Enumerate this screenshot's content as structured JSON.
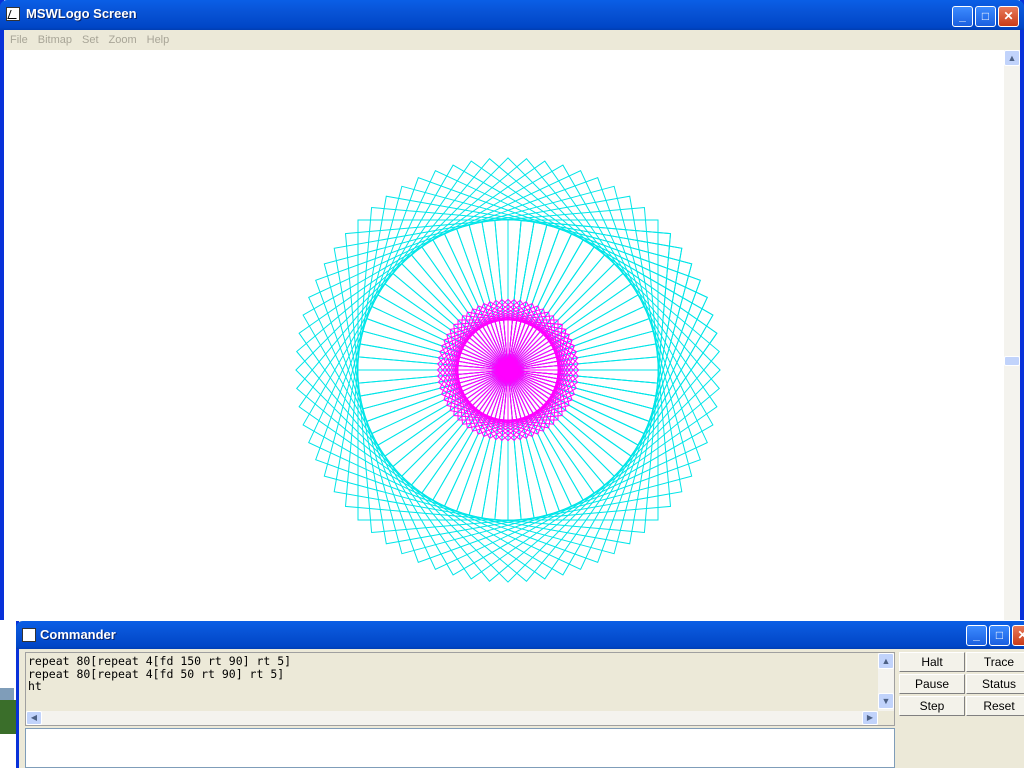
{
  "main_window": {
    "title": "MSWLogo Screen",
    "controls": {
      "minimize": "_",
      "maximize": "□",
      "close": "✕"
    },
    "menu": [
      "File",
      "Bitmap",
      "Set",
      "Zoom",
      "Help"
    ]
  },
  "drawing": {
    "shapes": [
      {
        "name": "large-square-rosette",
        "repeat": 80,
        "side": 150,
        "turn": 5,
        "color": "#00e5e8"
      },
      {
        "name": "small-square-rosette",
        "repeat": 80,
        "side": 50,
        "turn": 5,
        "color": "#ff00ff"
      }
    ]
  },
  "commander": {
    "title": "Commander",
    "history": [
      "repeat 80[repeat 4[fd 150 rt 90] rt 5]",
      "repeat 80[repeat 4[fd 50 rt 90] rt 5]",
      "ht"
    ],
    "input_value": "",
    "buttons": {
      "halt": "Halt",
      "trace": "Trace",
      "pause": "Pause",
      "status": "Status",
      "step": "Step",
      "reset": "Reset"
    }
  },
  "colors": {
    "titlebar": "#0853d6",
    "menubar": "#ece9d8",
    "cyan_pen": "#00e5e8",
    "magenta_pen": "#ff00ff"
  }
}
